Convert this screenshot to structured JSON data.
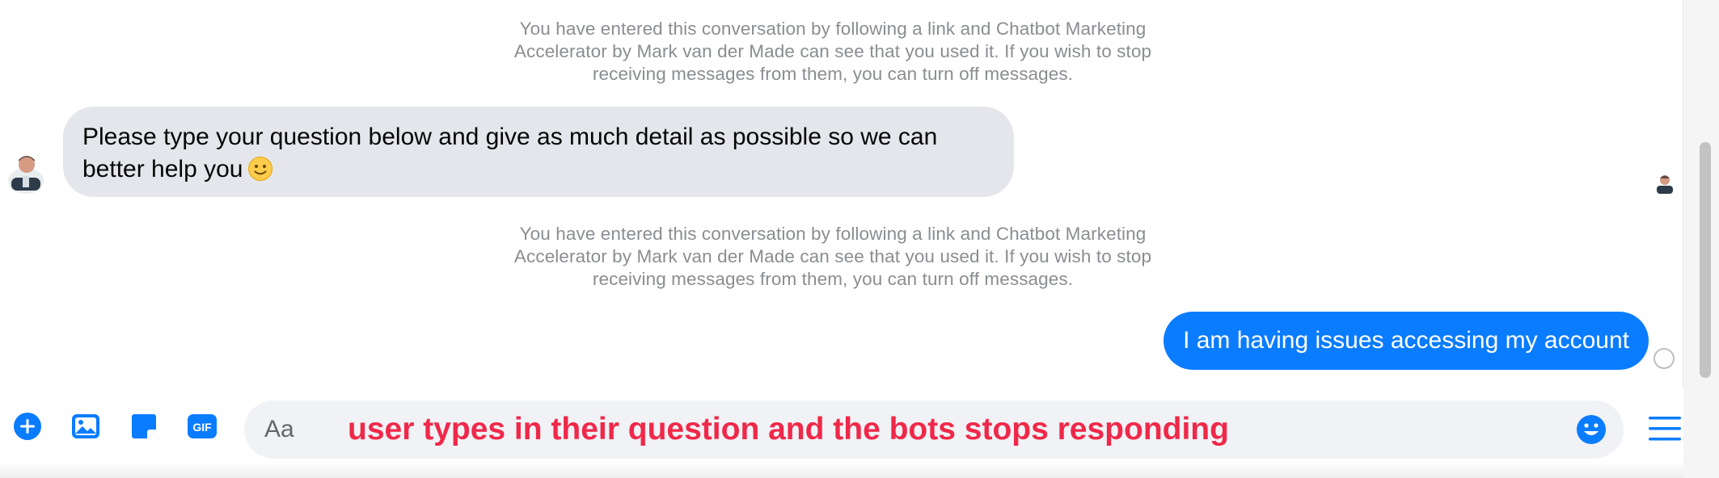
{
  "conversation": {
    "system_notices": [
      "You have entered this conversation by following a link and Chatbot Marketing\nAccelerator by Mark van der Made can see that you used it. If you wish to stop\nreceiving messages from them, you can turn off messages.",
      "You have entered this conversation by following a link and Chatbot Marketing\nAccelerator by Mark van der Made can see that you used it. If you wish to stop\nreceiving messages from them, you can turn off messages."
    ],
    "bot_message": "Please type your question below and give as much detail as possible so we can better help you",
    "bot_message_emoji": "slightly-smiling-face-emoji",
    "user_message": "I am having issues accessing my account"
  },
  "composer": {
    "placeholder": "Aa",
    "annotation": "user types in their question and the bots stops responding",
    "icons": [
      "plus-icon",
      "photo-icon",
      "sticker-icon",
      "gif-icon",
      "emoji-icon",
      "menu-icon"
    ]
  },
  "colors": {
    "messenger_blue": "#0a7cff",
    "incoming_bubble": "#e4e6eb",
    "annotation_red": "#f02849",
    "notice_gray": "#8a8d91"
  }
}
